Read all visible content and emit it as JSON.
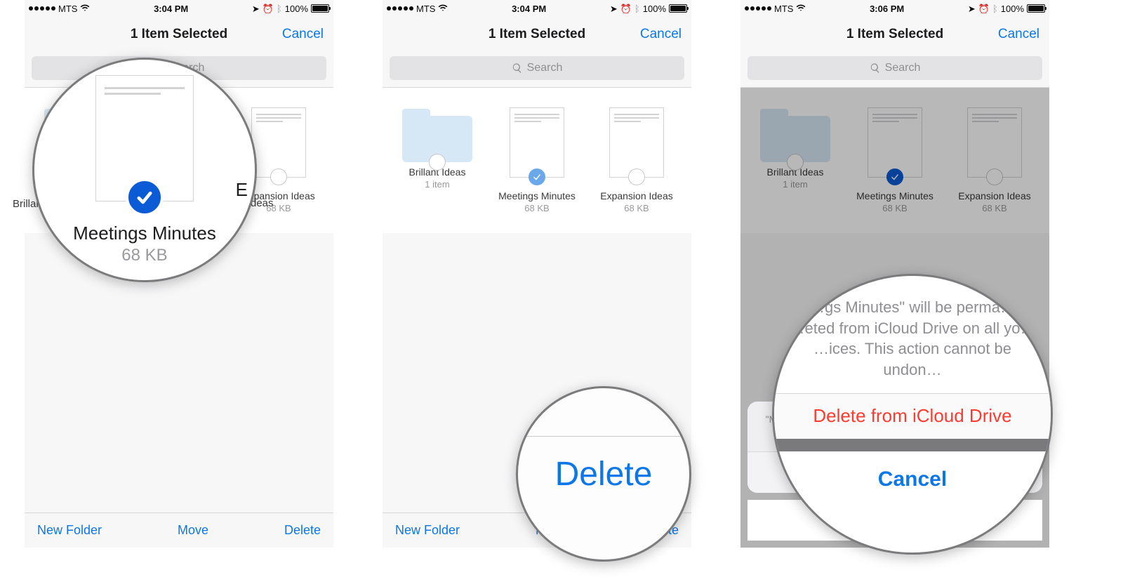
{
  "status": {
    "carrier": "MTS",
    "time1": "3:04 PM",
    "time2": "3:04 PM",
    "time3": "3:06 PM",
    "battery_pct": "100%"
  },
  "nav": {
    "title": "1 Item Selected",
    "cancel": "Cancel"
  },
  "search": {
    "placeholder": "Search"
  },
  "items": [
    {
      "name": "Brillant Ideas",
      "sub": "1 item",
      "type": "folder",
      "selected": false
    },
    {
      "name": "Meetings Minutes",
      "sub": "68 KB",
      "type": "doc",
      "selected": true
    },
    {
      "name": "Expansion Ideas",
      "sub": "68 KB",
      "type": "doc",
      "selected": false
    }
  ],
  "toolbar": {
    "new_folder": "New Folder",
    "move": "Move",
    "delete": "Delete"
  },
  "sheet": {
    "message": "\"Meetings Minutes\" will be permanently deleted from iCloud Drive on all your devices. This action cannot be undone.",
    "delete": "Delete from iCloud Drive",
    "cancel": "Cancel"
  },
  "mag1": {
    "name": "Meetings Minutes",
    "sub": "68 KB",
    "left_label": "Brillant",
    "right_frag": "E"
  },
  "mag2": {
    "label": "Delete"
  },
  "mag3": {
    "msg_l1": "…gs Minutes\" will be perma…",
    "msg_l2": "…eted from iCloud Drive on all yo…",
    "msg_l3": "…ices. This action cannot be undon…",
    "delete": "Delete from iCloud Drive",
    "cancel": "Cancel"
  },
  "edge": {
    "ideas": "deas"
  }
}
